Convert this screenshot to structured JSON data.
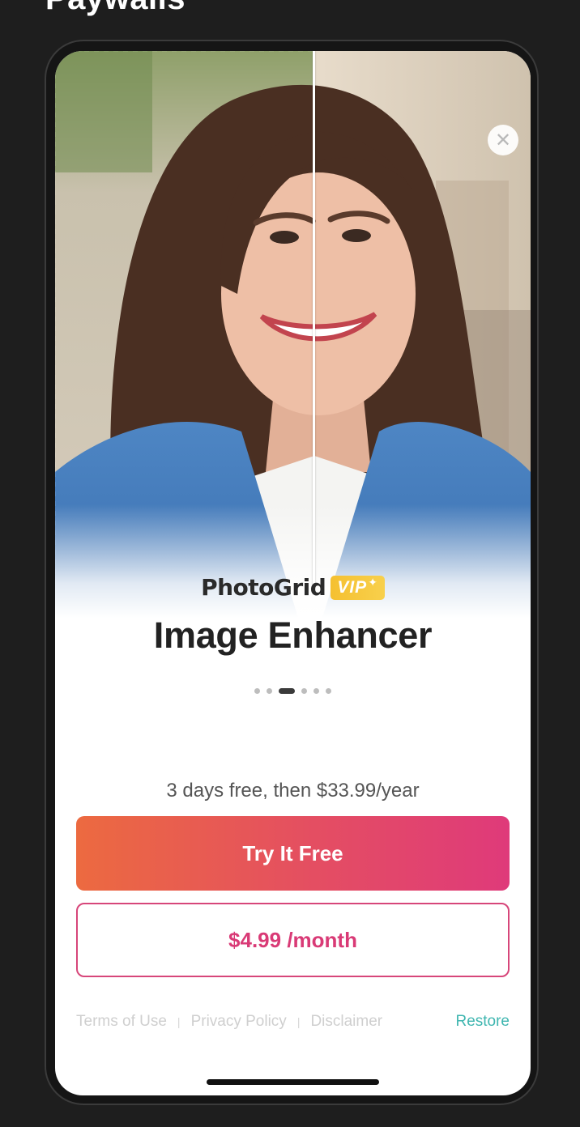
{
  "page": {
    "heading": "Paywalls"
  },
  "paywall": {
    "brand": {
      "name": "PhotoGrid",
      "badge": "VIP"
    },
    "title": "Image Enhancer",
    "pager": {
      "count": 6,
      "active_index": 2
    },
    "offer": "3 days free, then $33.99/year",
    "primary_cta": "Try It Free",
    "secondary_cta": "$4.99 /month",
    "footer": {
      "terms": "Terms of Use",
      "privacy": "Privacy Policy",
      "disclaimer": "Disclaimer",
      "restore": "Restore",
      "separator": "|"
    },
    "close_icon": "close-icon",
    "colors": {
      "cta_gradient_start": "#ec6a40",
      "cta_gradient_end": "#df3a7a",
      "secondary_accent": "#d93a76",
      "restore_link": "#3fb6b0",
      "vip_badge": "#f5c030"
    }
  }
}
